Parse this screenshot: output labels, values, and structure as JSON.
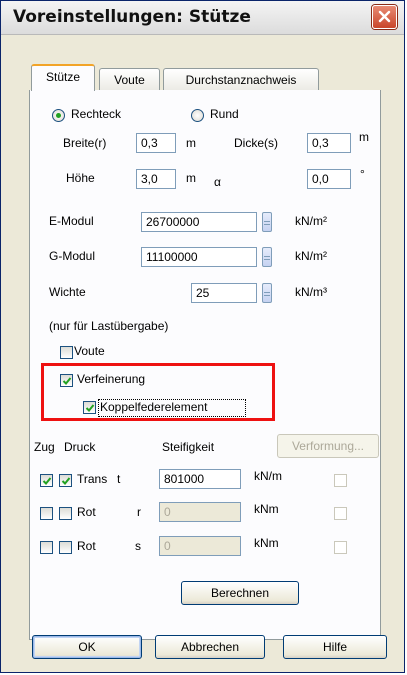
{
  "window": {
    "title": "Voreinstellungen: Stütze"
  },
  "tabs": [
    {
      "label": "Stütze",
      "active": true
    },
    {
      "label": "Voute",
      "active": false
    },
    {
      "label": "Durchstanznachweis",
      "active": false
    }
  ],
  "shape": {
    "rechteck_label": "Rechteck",
    "rund_label": "Rund",
    "selected": "Rechteck"
  },
  "dimensions": {
    "breite_label": "Breite(r)",
    "breite_value": "0,3",
    "breite_unit": "m",
    "dicke_label": "Dicke(s)",
    "dicke_value": "0,3",
    "dicke_unit": "m",
    "hoehe_label": "Höhe",
    "hoehe_value": "3,0",
    "hoehe_unit": "m",
    "alpha_label": "α",
    "alpha_value": "0,0",
    "alpha_unit": "°"
  },
  "materials": {
    "emodul_label": "E-Modul",
    "emodul_value": "26700000",
    "emodul_unit": "kN/m²",
    "gmodul_label": "G-Modul",
    "gmodul_value": "11100000",
    "gmodul_unit": "kN/m²",
    "wichte_label": "Wichte",
    "wichte_value": "25",
    "wichte_unit": "kN/m³"
  },
  "options": {
    "note": "(nur für Lastübergabe)",
    "voute_label": "Voute",
    "voute_checked": false,
    "verfeinerung_label": "Verfeinerung",
    "verfeinerung_checked": true,
    "koppel_label": "Koppelfederelement",
    "koppel_checked": true
  },
  "springs": {
    "zug_label": "Zug",
    "druck_label": "Druck",
    "steifigkeit_label": "Steifigkeit",
    "verformung_label": "Verformung...",
    "rows": [
      {
        "label": "Trans",
        "dir": "t",
        "zug": true,
        "druck": true,
        "value": "801000",
        "unit": "kN/m",
        "enabled": true
      },
      {
        "label": "Rot",
        "dir": "r",
        "zug": false,
        "druck": false,
        "value": "0",
        "unit": "kNm",
        "enabled": false
      },
      {
        "label": "Rot",
        "dir": "s",
        "zug": false,
        "druck": false,
        "value": "0",
        "unit": "kNm",
        "enabled": false
      }
    ],
    "berechnen_label": "Berechnen"
  },
  "footer": {
    "ok_label": "OK",
    "abbrechen_label": "Abbrechen",
    "hilfe_label": "Hilfe"
  },
  "colors": {
    "highlight": "#ee1111",
    "check": "#21a121"
  }
}
